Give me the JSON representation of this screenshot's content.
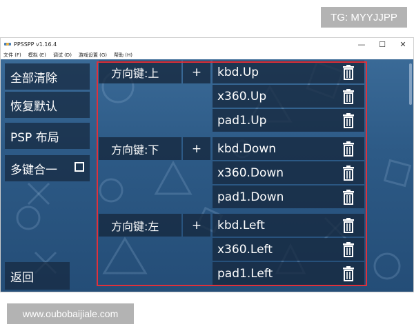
{
  "watermark": {
    "tg": "TG: MYYJJPP",
    "url": "www.oubobaijiale.com"
  },
  "window": {
    "title": "PPSSPP v1.16.4",
    "controls": {
      "minimize": "—",
      "maximize": "☐",
      "close": "✕"
    }
  },
  "menubar": [
    "文件 (F)",
    "模拟 (E)",
    "调试 (D)",
    "游戏设置 (G)",
    "帮助 (H)"
  ],
  "left_menu": {
    "clear_all": "全部清除",
    "restore_default": "恢复默认",
    "psp_layout": "PSP 布局",
    "multi_key": "多键合一",
    "back": "返回"
  },
  "plus_label": "+",
  "mappings": [
    {
      "label": "方向键:上",
      "keys": [
        "kbd.Up",
        "x360.Up",
        "pad1.Up"
      ]
    },
    {
      "label": "方向键:下",
      "keys": [
        "kbd.Down",
        "x360.Down",
        "pad1.Down"
      ]
    },
    {
      "label": "方向键:左",
      "keys": [
        "kbd.Left",
        "x360.Left",
        "pad1.Left"
      ]
    }
  ],
  "colors": {
    "background": "#2d5a86",
    "button": "#16283e",
    "highlight_frame": "#e0303a",
    "text": "#ffffff"
  },
  "icons": {
    "delete": "trash-icon",
    "checkbox": "checkbox-unchecked-icon"
  }
}
